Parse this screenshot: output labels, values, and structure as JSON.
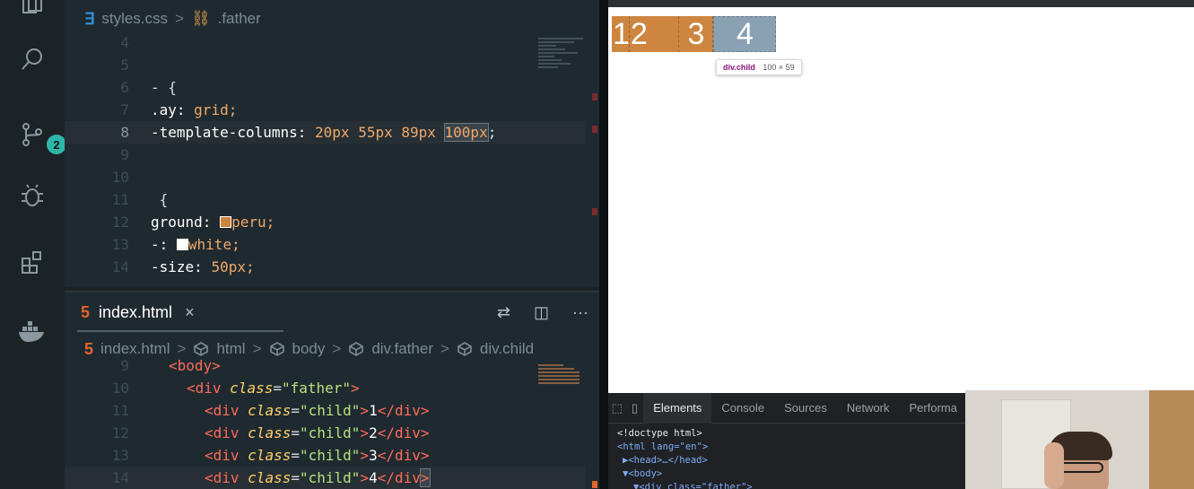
{
  "activity_bar": {
    "scm_badge": "2"
  },
  "css_editor": {
    "breadcrumb": {
      "file": "styles.css",
      "selector": ".father"
    },
    "lines": [
      {
        "n": "4",
        "text": ""
      },
      {
        "n": "5",
        "text": ""
      },
      {
        "n": "6",
        "text": "- {"
      },
      {
        "n": "7",
        "prop": ".ay:",
        "val": "grid;"
      },
      {
        "n": "8",
        "prop": "-template-columns:",
        "val": "20px 55px 89px",
        "sel": "100px",
        "end": ";"
      },
      {
        "n": "9",
        "text": ""
      },
      {
        "n": "10",
        "text": ""
      },
      {
        "n": "11",
        "text": " {"
      },
      {
        "n": "12",
        "prop": "ground:",
        "val": "peru;"
      },
      {
        "n": "13",
        "prop": "-:",
        "val": "white;"
      },
      {
        "n": "14",
        "prop": "-size:",
        "val": "50px;"
      }
    ]
  },
  "html_editor": {
    "tab_label": "index.html",
    "close": "×",
    "more": "···",
    "breadcrumb": [
      "index.html",
      "html",
      "body",
      "div.father",
      "div.child"
    ],
    "lines": [
      {
        "n": "9",
        "text": "<body>"
      },
      {
        "n": "10",
        "text": "<div class=\"father\">"
      },
      {
        "n": "11",
        "text": "<div class=\"child\">1</div>"
      },
      {
        "n": "12",
        "text": "<div class=\"child\">2</div>"
      },
      {
        "n": "13",
        "text": "<div class=\"child\">3</div>"
      },
      {
        "n": "14",
        "text": "<div class=\"child\">4</div>"
      }
    ]
  },
  "browser": {
    "children": [
      "1",
      "2",
      "3",
      "4"
    ],
    "tooltip": {
      "selector": "div.child",
      "size": "100 × 59"
    }
  },
  "devtools": {
    "tabs": [
      "Elements",
      "Console",
      "Sources",
      "Network",
      "Performa"
    ],
    "dom": {
      "doctype": "<!doctype html>",
      "html_open": "<html lang=\"en\">",
      "head": "▶<head>…</head>",
      "body": "▼<body>",
      "father": "▼<div class=\"father\">"
    }
  },
  "colors": {
    "peru": "#cd853f",
    "selected_cell": "#8aa0b3",
    "editor_bg": "#1f2a30"
  }
}
